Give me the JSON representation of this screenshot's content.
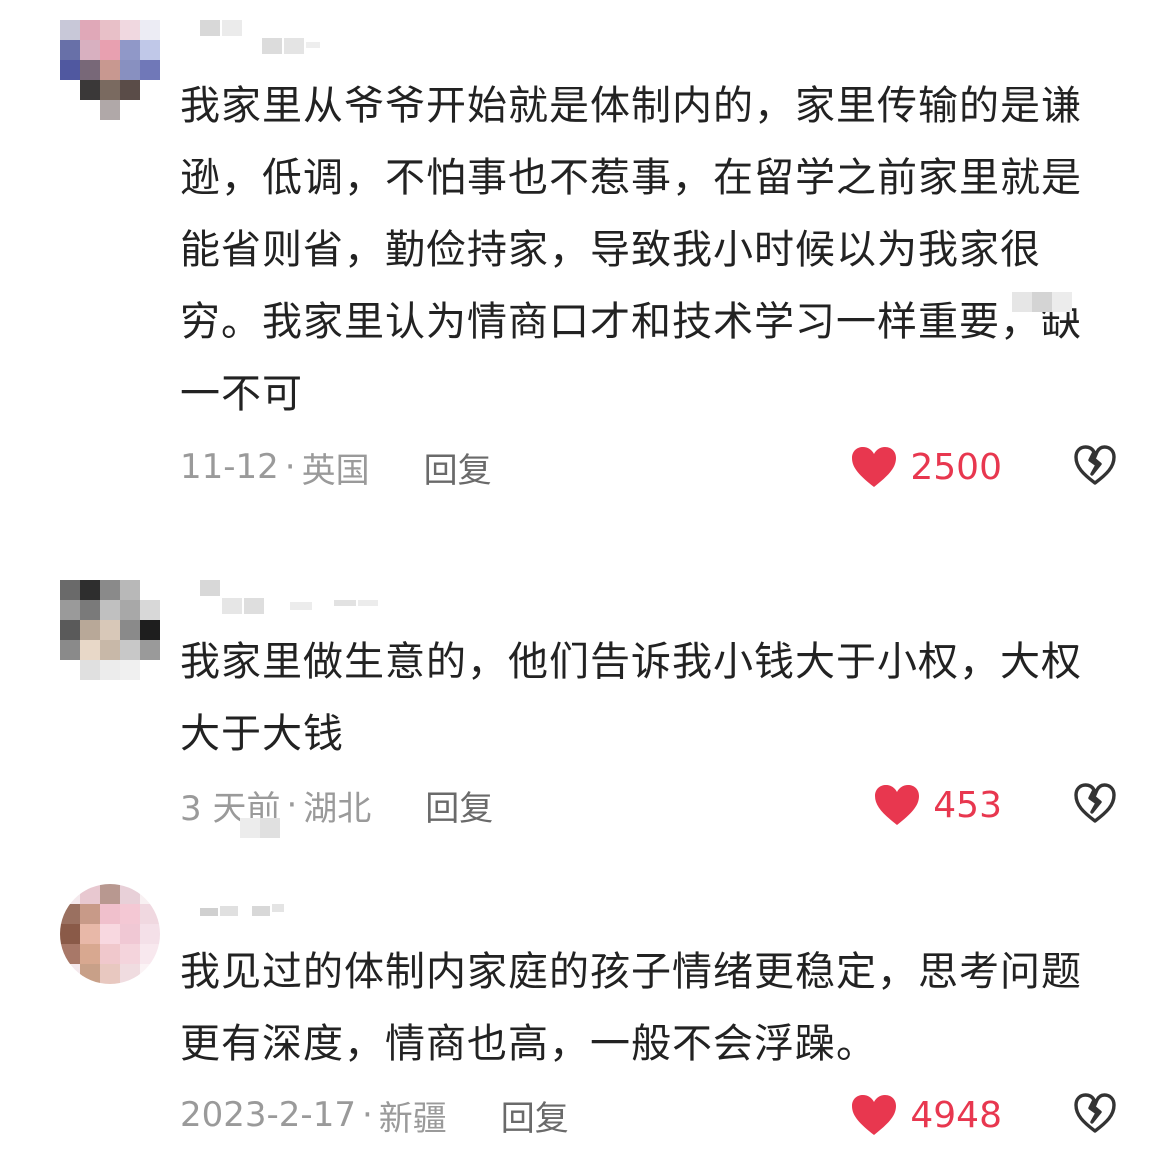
{
  "comments": [
    {
      "text": "我家里从爷爷开始就是体制内的，家里传输的是谦逊，低调，不怕事也不惹事，在留学之前家里就是能省则省，勤俭持家，导致我小时候以为我家很穷。我家里认为情商口才和技术学习一样重要，缺一不可",
      "date": "11-12",
      "location": "英国",
      "reply_label": "回复",
      "likes": "2500"
    },
    {
      "text": "我家里做生意的，他们告诉我小钱大于小权，大权大于大钱",
      "date": "3 天前",
      "location": "湖北",
      "reply_label": "回复",
      "likes": "453"
    },
    {
      "text": "我见过的体制内家庭的孩子情绪更稳定，思考问题更有深度，情商也高，一般不会浮躁。",
      "date": "2023-2-17",
      "location": "新疆",
      "reply_label": "回复",
      "likes": "4948"
    }
  ],
  "meta_separator": "·",
  "colors": {
    "like": "#e8374f",
    "meta": "#9a9a9a",
    "reply": "#6a6a6a",
    "text": "#222222",
    "dislike_icon": "#333333"
  },
  "icons": {
    "like": "heart-icon",
    "dislike": "broken-heart-icon"
  }
}
